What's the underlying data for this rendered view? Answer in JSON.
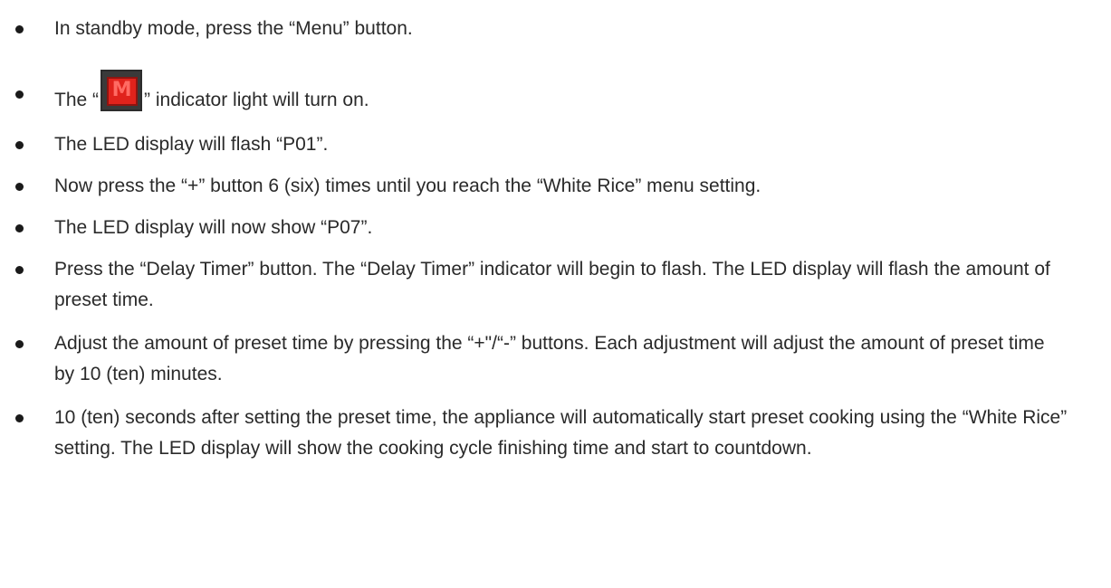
{
  "list": {
    "items": [
      {
        "text": "In standby mode, press the “Menu” button."
      },
      {
        "text_before": "The “",
        "icon": "menu-m-indicator-icon",
        "icon_glyph": "M",
        "text_after": "” indicator light will turn on."
      },
      {
        "text": "The LED display will flash “P01”."
      },
      {
        "text": "Now press the “+” button 6 (six) times until you reach the “White Rice” menu setting."
      },
      {
        "text": "The LED display will now show “P07”."
      },
      {
        "text": "Press the “Delay Timer” button.  The “Delay Timer” indicator will begin to flash.  The LED display will flash the amount of preset time."
      },
      {
        "text": "Adjust the amount of preset time by pressing the “+\"/“-” buttons.  Each adjustment will adjust the amount of preset time by 10 (ten) minutes."
      },
      {
        "text": "10 (ten) seconds after setting the preset time, the appliance will automatically start preset cooking using the “White Rice” setting.  The LED display will show the cooking cycle finishing time and start to countdown."
      }
    ]
  },
  "colors": {
    "text": "#2a2a2a",
    "icon_bg": "#3a3a3a",
    "icon_red": "#e0231c",
    "icon_glyph": "#ff6b63"
  }
}
